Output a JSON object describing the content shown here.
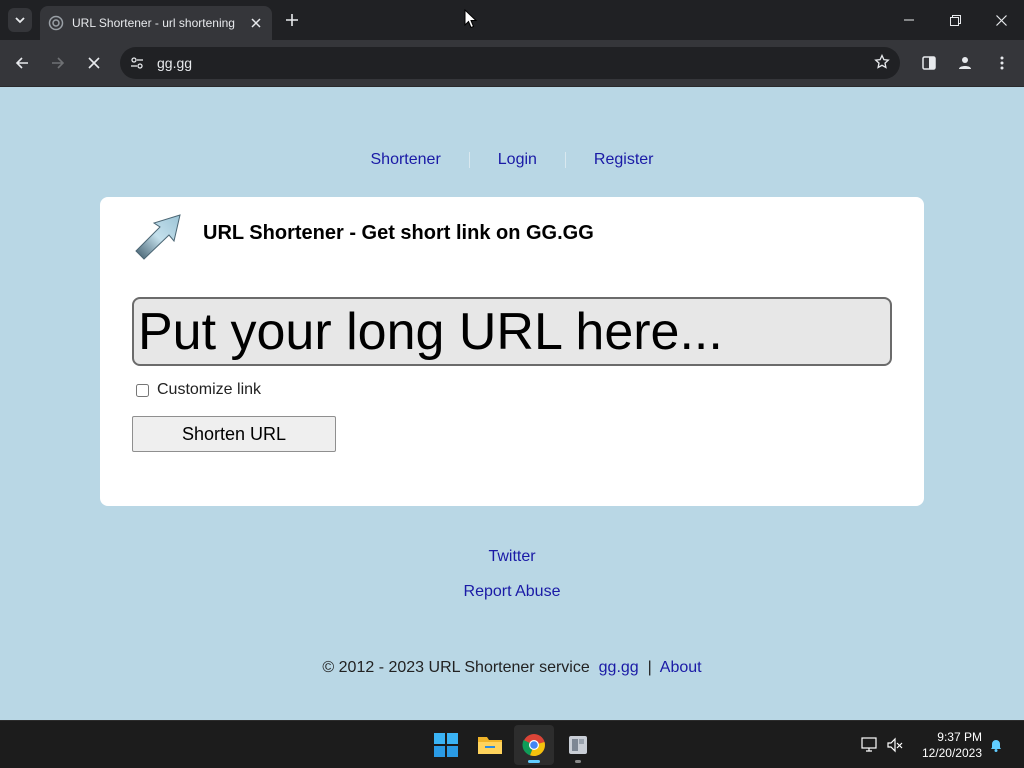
{
  "browser": {
    "tab_title": "URL Shortener - url shortening",
    "address": "gg.gg"
  },
  "page": {
    "nav": [
      "Shortener",
      "Login",
      "Register"
    ],
    "card_title": "URL Shortener - Get short link on GG.GG",
    "url_placeholder": "Put your long URL here...",
    "customize_label": "Customize link",
    "shorten_button": "Shorten URL",
    "footer_links": [
      "Twitter",
      "Report Abuse"
    ],
    "copyright_text": "© 2012 - 2023 URL Shortener service",
    "copyright_link_site": "gg.gg",
    "copyright_sep": "|",
    "copyright_link_about": "About"
  },
  "taskbar": {
    "time": "9:37 PM",
    "date": "12/20/2023"
  },
  "colors": {
    "page_bg": "#b9d7e5",
    "link": "#1a1aa6",
    "chrome_dark": "#202124",
    "chrome_toolbar": "#35363a"
  }
}
